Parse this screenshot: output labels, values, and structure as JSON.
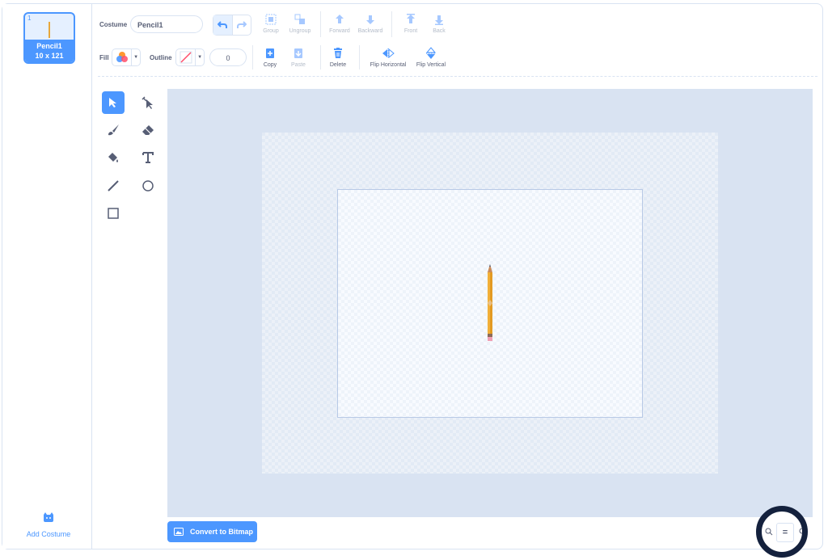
{
  "sidebar": {
    "costumes": [
      {
        "number": "1",
        "name": "Pencil1",
        "size": "10 x 121",
        "selected": true
      }
    ],
    "add_costume_label": "Add Costume"
  },
  "toolbar": {
    "costume_label": "Costume",
    "costume_name": "Pencil1",
    "fill_label": "Fill",
    "outline_label": "Outline",
    "outline_width": "0",
    "buttons": {
      "group": "Group",
      "ungroup": "Ungroup",
      "forward": "Forward",
      "backward": "Backward",
      "front": "Front",
      "back": "Back",
      "copy": "Copy",
      "paste": "Paste",
      "delete": "Delete",
      "flip_horizontal": "Flip Horizontal",
      "flip_vertical": "Flip Vertical"
    }
  },
  "tools": [
    "select",
    "reshape",
    "brush",
    "eraser",
    "fill",
    "text",
    "line",
    "circle",
    "rectangle"
  ],
  "active_tool": "select",
  "convert_button": "Convert to Bitmap",
  "zoom": {
    "reset_label": "=",
    "out_label": "−",
    "in_label": "+"
  },
  "colors": {
    "accent": "#4c97ff",
    "stage_bg": "#d9e3f2",
    "pencil": "#e8a73b"
  }
}
